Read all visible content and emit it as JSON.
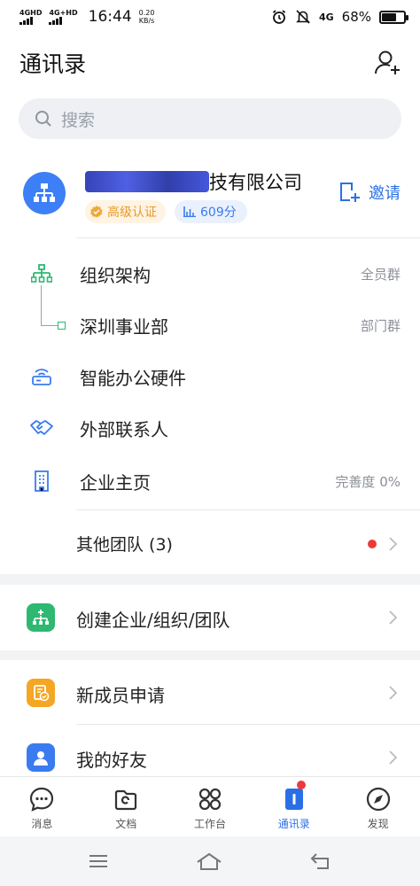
{
  "status_bar": {
    "net1": "4GHD",
    "net2": "4G+HD",
    "time": "16:44",
    "speed_value": "0.20",
    "speed_unit": "KB/s",
    "net3": "4G",
    "battery": "68%",
    "battery_level": 0.68
  },
  "header": {
    "title": "通讯录"
  },
  "search": {
    "placeholder": "搜索"
  },
  "company": {
    "name_visible": "技有限公司",
    "cert_label": "高级认证",
    "score": "609分",
    "invite_label": "邀请"
  },
  "org": {
    "structure_label": "组织架构",
    "structure_tail": "全员群",
    "dept_label": "深圳事业部",
    "dept_tail": "部门群",
    "hardware_label": "智能办公硬件",
    "external_label": "外部联系人",
    "homepage_label": "企业主页",
    "homepage_tail": "完善度 0%"
  },
  "other_teams": {
    "label": "其他团队 (3)"
  },
  "create": {
    "label": "创建企业/组织/团队"
  },
  "new_member": {
    "label": "新成员申请"
  },
  "friends": {
    "label": "我的好友"
  },
  "tabs": [
    {
      "label": "消息"
    },
    {
      "label": "文档"
    },
    {
      "label": "工作台"
    },
    {
      "label": "通讯录"
    },
    {
      "label": "发现"
    }
  ],
  "colors": {
    "accent": "#2b6fe6",
    "green": "#2eb872",
    "orange": "#f5a623",
    "red": "#ec3a3a"
  }
}
